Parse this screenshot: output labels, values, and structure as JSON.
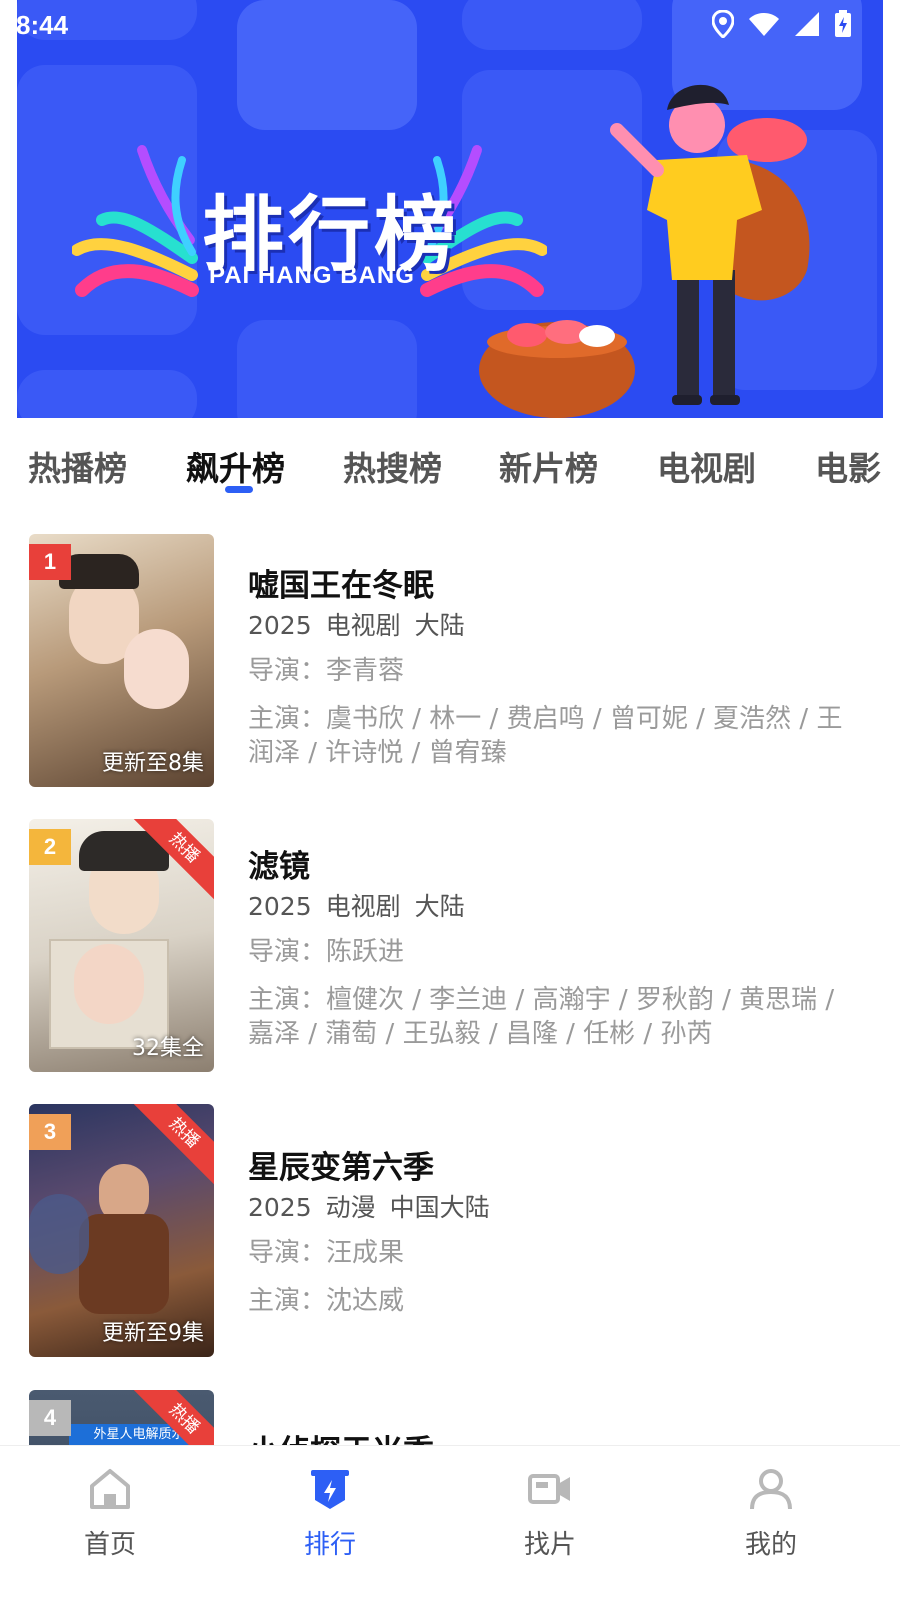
{
  "status_bar": {
    "time": "8:44",
    "icons": [
      "location-icon",
      "wifi-icon",
      "signal-icon",
      "battery-icon"
    ]
  },
  "banner": {
    "title": "排行榜",
    "subtitle": "PAI HANG BANG",
    "bg_color": "#2b4bf2"
  },
  "tabs": [
    {
      "label": "热播榜",
      "active": false
    },
    {
      "label": "飙升榜",
      "active": true
    },
    {
      "label": "热搜榜",
      "active": false
    },
    {
      "label": "新片榜",
      "active": false
    },
    {
      "label": "电视剧",
      "active": false
    },
    {
      "label": "电影",
      "active": false
    }
  ],
  "items": [
    {
      "rank": "1",
      "rank_color": "#e8403a",
      "hot_badge": "",
      "episodes": "更新至8集",
      "title": "嘘国王在冬眠",
      "year": "2025",
      "genre": "电视剧",
      "region": "大陆",
      "director": "导演：李青蓉",
      "cast": "主演：虞书欣 / 林一 / 费启鸣 / 曾可妮 / 夏浩然 / 王润泽 / 许诗悦 / 曾宥臻"
    },
    {
      "rank": "2",
      "rank_color": "#f4b63c",
      "hot_badge": "热播",
      "episodes": "32集全",
      "title": "滤镜",
      "year": "2025",
      "genre": "电视剧",
      "region": "大陆",
      "director": "导演：陈跃进",
      "cast": "主演：檀健次 / 李兰迪 / 高瀚宇 / 罗秋韵 / 黄思瑞 / 嘉泽 / 蒲萄 / 王弘毅 / 昌隆 / 任彬 / 孙芮"
    },
    {
      "rank": "3",
      "rank_color": "#f0a058",
      "hot_badge": "热播",
      "episodes": "更新至9集",
      "title": "星辰变第六季",
      "year": "2025",
      "genre": "动漫",
      "region": "中国大陆",
      "director": "导演：汪成果",
      "cast": "主演：沈达威"
    },
    {
      "rank": "4",
      "rank_color": "#b8b8b8",
      "hot_badge": "热播",
      "episodes": "",
      "title": "小侦探于米季",
      "poster_text": "外星人电解质水"
    }
  ],
  "bottom_nav": [
    {
      "label": "首页",
      "icon": "home-icon",
      "active": false
    },
    {
      "label": "排行",
      "icon": "ranking-icon",
      "active": true
    },
    {
      "label": "找片",
      "icon": "video-icon",
      "active": false
    },
    {
      "label": "我的",
      "icon": "profile-icon",
      "active": false
    }
  ],
  "colors": {
    "accent": "#2d5ff5",
    "hot": "#e8403a"
  }
}
